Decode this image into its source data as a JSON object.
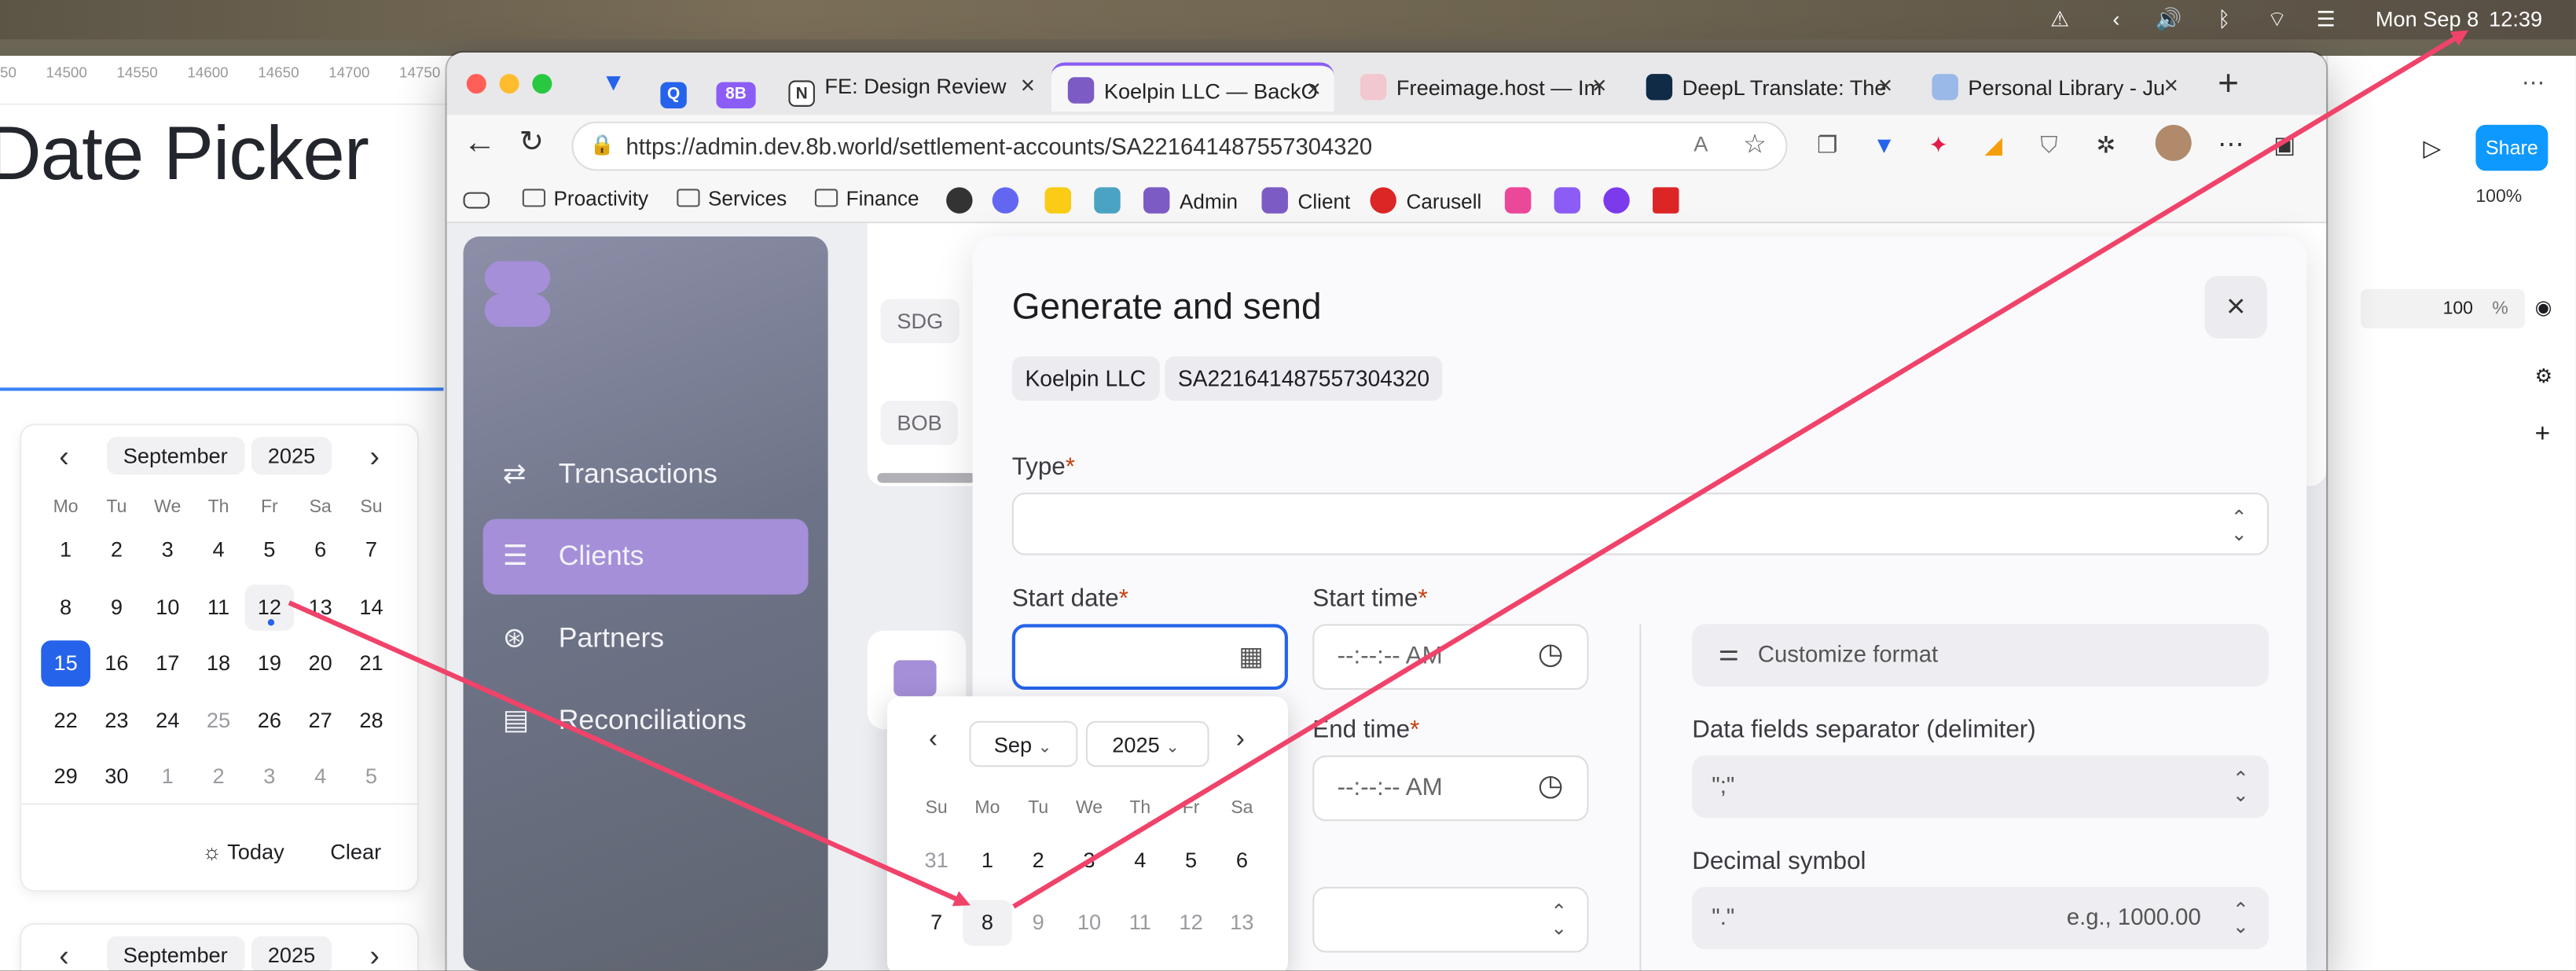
{
  "menubar": {
    "date": "Mon Sep 8",
    "time": "12:39"
  },
  "figma": {
    "ruler": [
      "50",
      "14500",
      "14550",
      "14600",
      "14650",
      "14700",
      "14750"
    ],
    "title": "Date Picker",
    "share": "Share",
    "zoom": "100%",
    "opacity": "100",
    "percent": "%",
    "calendar": {
      "month": "September",
      "year": "2025",
      "weekdays": [
        "Mo",
        "Tu",
        "We",
        "Th",
        "Fr",
        "Sa",
        "Su"
      ],
      "rows": [
        [
          "1",
          "2",
          "3",
          "4",
          "5",
          "6",
          "7"
        ],
        [
          "8",
          "9",
          "10",
          "11",
          "12",
          "13",
          "14"
        ],
        [
          "15",
          "16",
          "17",
          "18",
          "19",
          "20",
          "21"
        ],
        [
          "22",
          "23",
          "24",
          "25",
          "26",
          "27",
          "28"
        ],
        [
          "29",
          "30",
          "1",
          "2",
          "3",
          "4",
          "5"
        ]
      ],
      "today_label": "Today",
      "clear_label": "Clear"
    },
    "calendar2": {
      "month": "September",
      "year": "2025"
    }
  },
  "browser": {
    "tabs": [
      {
        "label": "Q"
      },
      {
        "label": "8B"
      },
      {
        "label": "FE: Design Review"
      },
      {
        "label": "Koelpin LLC — BackO"
      },
      {
        "label": "Freeimage.host — Im"
      },
      {
        "label": "DeepL Translate: The"
      },
      {
        "label": "Personal Library - Ju"
      }
    ],
    "url": "https://admin.dev.8b.world/settlement-accounts/SA221641487557304320",
    "bookmarks": [
      "Proactivity",
      "Services",
      "Finance",
      "Admin",
      "Client",
      "Carusell"
    ]
  },
  "sidebar": {
    "items": [
      "Transactions",
      "Clients",
      "Partners",
      "Reconciliations"
    ]
  },
  "list": {
    "row_tags": [
      "SDG",
      "BOB"
    ]
  },
  "modal": {
    "title": "Generate and send",
    "chips": [
      "Koelpin LLC",
      "SA221641487557304320"
    ],
    "type_label": "Type",
    "start_date_label": "Start date",
    "start_time_label": "Start time",
    "end_time_label": "End time",
    "time_placeholder": "--:--:-- AM",
    "customize_label": "Customize format",
    "delimiter_label": "Data fields separator (delimiter)",
    "delimiter_value": "\";\"",
    "decimal_label": "Decimal symbol",
    "decimal_value": "\".\"",
    "decimal_hint": "e.g., 1000.00"
  },
  "datepicker": {
    "month": "Sep",
    "year": "2025",
    "weekdays": [
      "Su",
      "Mo",
      "Tu",
      "We",
      "Th",
      "Fr",
      "Sa"
    ],
    "rows": [
      [
        "31",
        "1",
        "2",
        "3",
        "4",
        "5",
        "6"
      ],
      [
        "7",
        "8",
        "9",
        "10",
        "11",
        "12",
        "13"
      ]
    ]
  },
  "colors": {
    "accent": "#2563eb",
    "nav_active": "#a58fd8",
    "arrow": "#f0436a",
    "share": "#0d99ff"
  }
}
